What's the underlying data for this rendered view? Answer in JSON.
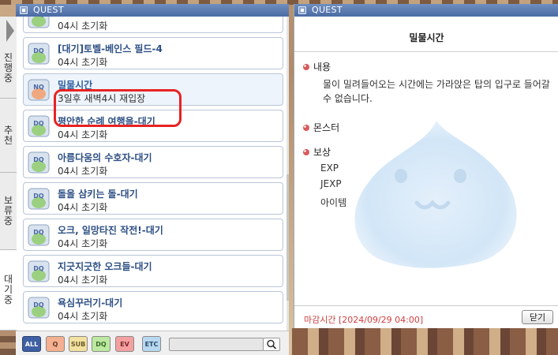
{
  "left_window": {
    "title": "QUEST",
    "tabs": [
      {
        "label": [
          "진",
          "행",
          "중"
        ]
      },
      {
        "label": [
          "추",
          "천"
        ]
      },
      {
        "label": [
          "보",
          "류",
          "중"
        ]
      },
      {
        "label": [
          "대",
          "기",
          "중"
        ]
      }
    ],
    "quests": [
      {
        "title": "",
        "sub": "04시 초기화",
        "icon": "DQ"
      },
      {
        "title": "[대기]토벨-베인스 필드-4",
        "sub": "04시 초기화",
        "icon": "DQ"
      },
      {
        "title": "밀물시간",
        "sub": "3일후 새벽4시 재입장",
        "icon": "NQ"
      },
      {
        "title": "평안한 순례 여행을-대기",
        "sub": "04시 초기화",
        "icon": "DQ"
      },
      {
        "title": "아름다움의 수호자-대기",
        "sub": "04시 초기화",
        "icon": "DQ"
      },
      {
        "title": "돌을 삼키는 돌-대기",
        "sub": "04시 초기화",
        "icon": "DQ"
      },
      {
        "title": "오크, 일망타진 작전!-대기",
        "sub": "04시 초기화",
        "icon": "DQ"
      },
      {
        "title": "지긋지긋한 오크들-대기",
        "sub": "04시 초기화",
        "icon": "DQ"
      },
      {
        "title": "욕심꾸러기-대기",
        "sub": "04시 초기화",
        "icon": "DQ"
      }
    ],
    "filters": [
      "ALL",
      "Q",
      "SUB",
      "DQ",
      "EV",
      "ETC"
    ],
    "search_value": ""
  },
  "right_window": {
    "title": "QUEST",
    "quest_name": "밀물시간",
    "content_label": "내용",
    "content_text": "물이 밀려들어오는 시간에는 가라앉은 탑의 입구로 들어갈 수 없습니다.",
    "monster_label": "몬스터",
    "reward_label": "보상",
    "rewards": [
      "EXP",
      "JEXP",
      "아이템"
    ],
    "deadline": "마감시간 [2024/09/29 04:00]",
    "close_label": "닫기"
  },
  "colors": {
    "titlebar": "#4a6aa3",
    "quest_title": "#2d4f85",
    "highlight": "#e82323",
    "deadline": "#d04040"
  }
}
